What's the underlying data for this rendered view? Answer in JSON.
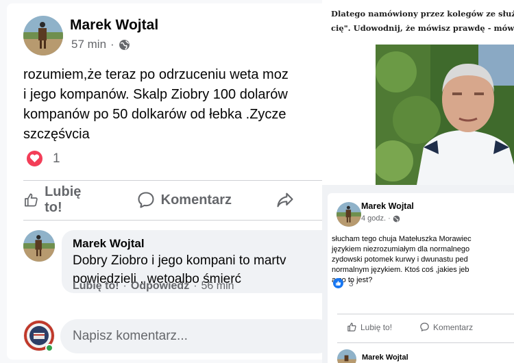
{
  "main_post": {
    "author": "Marek Wojtal",
    "time": "57 min",
    "separator": "·",
    "body_lines": [
      "rozumiem,że teraz po odrzuceniu weta moz",
      "i jego kompanów. Skalp Ziobry 100 dolarów",
      "kompanów po 50 dolkarów od łebka .Zycze",
      "szczęśvcia"
    ],
    "reaction_count": "1",
    "actions": {
      "like": "Lubię to!",
      "comment": "Komentarz"
    },
    "comment": {
      "author": "Marek Wojtal",
      "lines": [
        "Dobry Ziobro i jego kompani to martv",
        "powiedzieli , wetoalbo śmierć"
      ],
      "like": "Lubię to!",
      "sep1": "·",
      "reply": "Odpowiedz",
      "sep2": "·",
      "time": "56 min"
    },
    "write_placeholder": "Napisz komentarz..."
  },
  "article": {
    "lines": [
      "Dlatego namówiony przez kolegów ze służby",
      "cię\". Udowodnij, że mówisz prawdę - mówi w"
    ]
  },
  "second_post": {
    "author": "Marek Wojtal",
    "time": "4 godz.",
    "separator": "·",
    "body_lines": [
      "słucham tego chuja Matełuszka Morawiec",
      "językiem niezrozumiałym dla normalnego",
      "zydowski potomek kurwy i dwunastu ped",
      "normalnym językiem. Ktoś coś ,jakies jeb",
      "a co to jest?"
    ],
    "like_count": "3",
    "actions": {
      "like": "Lubię to!",
      "comment": "Komentarz"
    },
    "next_author": "Marek Wojtal"
  },
  "colors": {
    "heart": "#f33e58",
    "like_blue": "#1877f2",
    "online": "#31a24c",
    "meta_gray": "#65676b"
  }
}
